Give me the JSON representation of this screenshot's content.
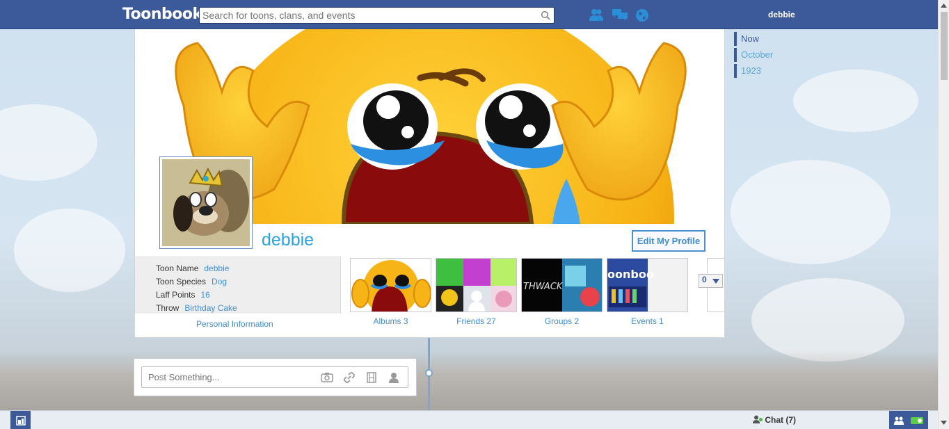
{
  "header": {
    "logo": "Toonbook",
    "search_placeholder": "Search for toons, clans, and events",
    "username": "debbie"
  },
  "timeline_nav": {
    "items": [
      "Now",
      "October",
      "1923"
    ]
  },
  "profile": {
    "name": "debbie",
    "edit_label": "Edit My Profile",
    "info": [
      {
        "label": "Toon Name",
        "value": "debbie"
      },
      {
        "label": "Toon Species",
        "value": "Dog"
      },
      {
        "label": "Laff Points",
        "value": "16"
      },
      {
        "label": "Throw",
        "value": "Birthday Cake"
      }
    ],
    "info_link": "Personal Information",
    "tiles": [
      {
        "label": "Albums 3"
      },
      {
        "label": "Friends 27"
      },
      {
        "label": "Groups 2"
      },
      {
        "label": "Events 1"
      }
    ],
    "more_count": "0",
    "groups_thumb_text": "THWACK",
    "events_thumb_text": "oonboo"
  },
  "composer": {
    "placeholder": "Post Something..."
  },
  "bottombar": {
    "chat_label": "Chat",
    "chat_count": "(7)"
  },
  "colors": {
    "brand": "#3c5a99",
    "link": "#3e8ed4",
    "name": "#2aa3e0"
  }
}
